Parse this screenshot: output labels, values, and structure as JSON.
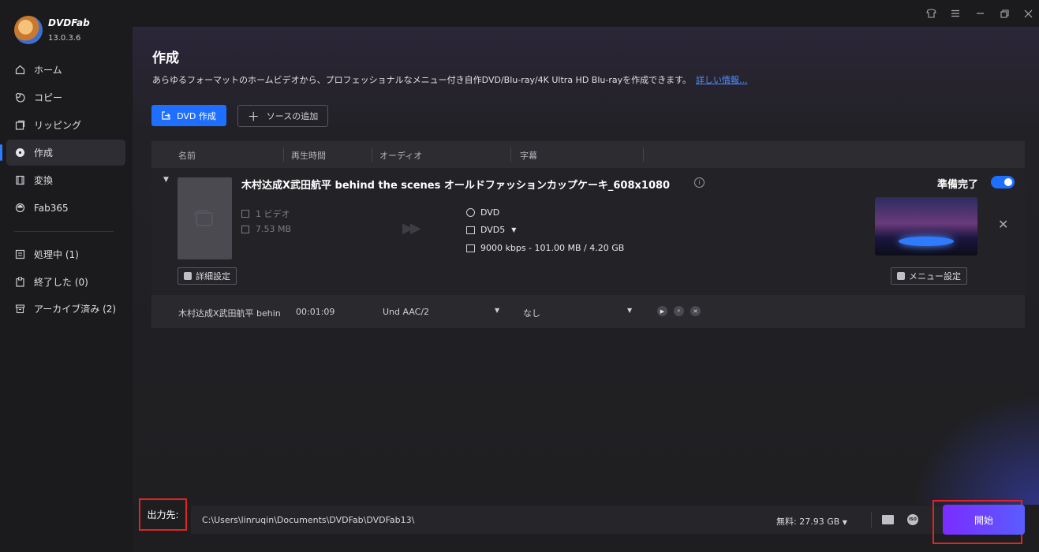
{
  "app": {
    "brand": "DVDFab",
    "version": "13.0.3.6"
  },
  "sidebar": {
    "items": [
      {
        "label": "ホーム",
        "icon": "home-icon"
      },
      {
        "label": "コピー",
        "icon": "copy-icon"
      },
      {
        "label": "リッピング",
        "icon": "ripper-icon"
      },
      {
        "label": "作成",
        "icon": "creator-icon",
        "active": true
      },
      {
        "label": "変換",
        "icon": "converter-icon"
      },
      {
        "label": "Fab365",
        "icon": "fab365-icon"
      }
    ],
    "queue": [
      {
        "label": "処理中 (1)",
        "icon": "processing-icon"
      },
      {
        "label": "終了した (0)",
        "icon": "finished-icon"
      },
      {
        "label": "アーカイブ済み (2)",
        "icon": "archive-icon"
      }
    ]
  },
  "main": {
    "title": "作成",
    "description": "あらゆるフォーマットのホームビデオから、プロフェッショナルなメニュー付き自作DVD/Blu-ray/4K Ultra HD Blu-rayを作成できます。",
    "more_link": "詳しい情報...",
    "create_button": "DVD 作成",
    "add_source_button": "ソースの追加"
  },
  "table": {
    "headers": [
      "名前",
      "再生時間",
      "オーディオ",
      "字幕"
    ]
  },
  "task": {
    "title": "木村达成X武田航平 behind the scenes オールドファッションカップケーキ_608x1080",
    "video_count": "1 ビデオ",
    "size": "7.53 MB",
    "output_format": "DVD",
    "disc_type": "DVD5",
    "bitrate": "9000 kbps - 101.00 MB / 4.20 GB",
    "status": "準備完了",
    "advanced_button": "詳細設定",
    "menu_button": "メニュー設定",
    "sub_row": {
      "name": "木村达成X武田航平 behin",
      "duration": "00:01:09",
      "audio": "Und  AAC/2",
      "subtitle": "なし"
    }
  },
  "bottom": {
    "dest_label": "出力先:",
    "path": "C:\\Users\\linruqin\\Documents\\DVDFab\\DVDFab13\\",
    "free_space": "無料:  27.93 GB",
    "start_button": "開始"
  },
  "colors": {
    "accent": "#1f6fff",
    "start": "#7b2cff",
    "highlight": "#e02424"
  }
}
